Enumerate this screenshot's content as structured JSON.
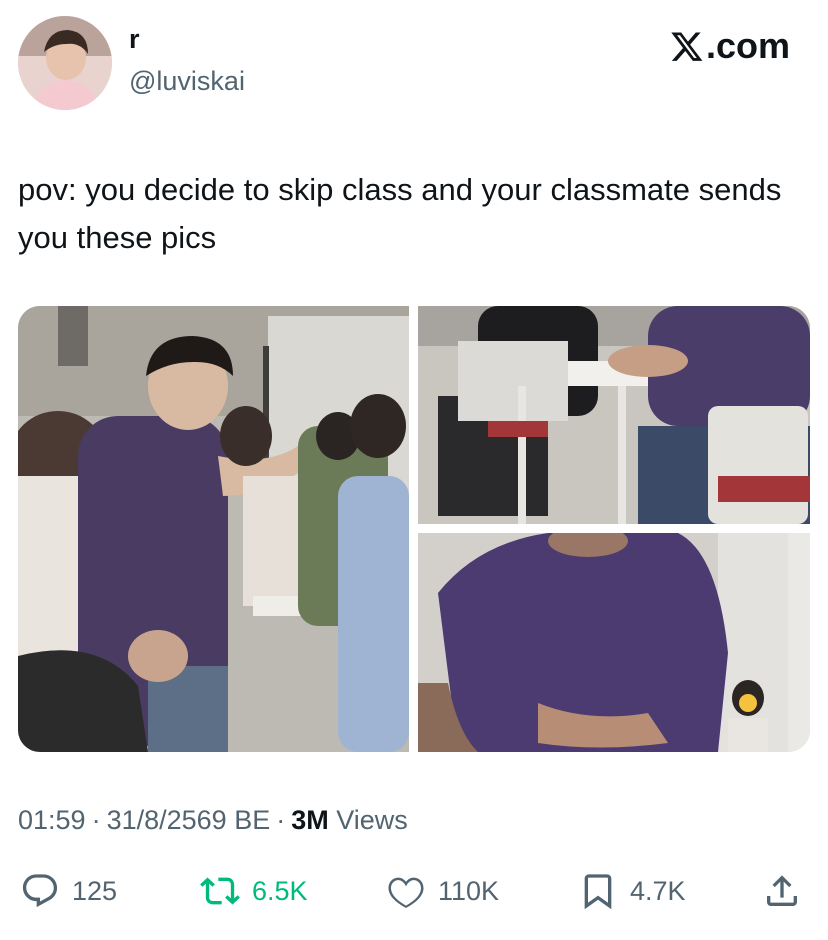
{
  "author": {
    "display_name": "r",
    "handle": "@luviskai"
  },
  "brand": {
    "label": ".com",
    "icon": "x-logo-icon"
  },
  "tweet": {
    "text": "pov: you decide to skip class and your classmate sends you these pics"
  },
  "meta": {
    "time": "01:59",
    "date": "31/8/2569 BE",
    "separator": "·",
    "views_count": "3M",
    "views_label": "Views"
  },
  "actions": {
    "reply": {
      "count": "125",
      "icon": "reply-icon"
    },
    "repost": {
      "count": "6.5K",
      "icon": "repost-icon",
      "color": "#00ba7c"
    },
    "like": {
      "count": "110K",
      "icon": "heart-icon"
    },
    "bookmark": {
      "count": "4.7K",
      "icon": "bookmark-icon"
    },
    "share": {
      "icon": "share-icon"
    }
  },
  "colors": {
    "text_primary": "#0f1419",
    "text_secondary": "#536471",
    "repost_green": "#00ba7c"
  }
}
